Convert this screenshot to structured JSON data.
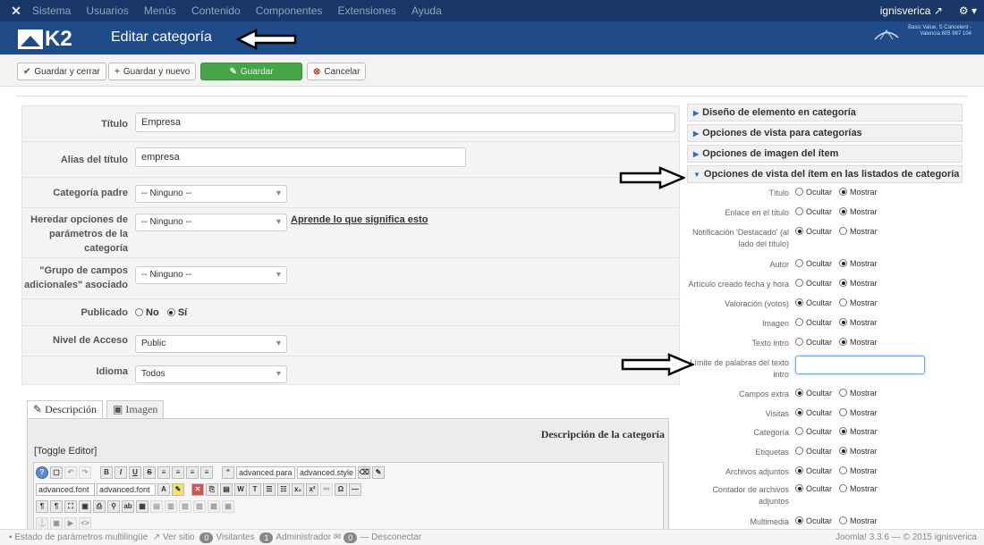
{
  "topbar": {
    "menu": [
      "Sistema",
      "Usuarios",
      "Menús",
      "Contenido",
      "Componentes",
      "Extensiones",
      "Ayuda"
    ],
    "user": "ignisverica"
  },
  "header": {
    "logo_text": "K2",
    "title": "Editar categoría",
    "brand_text": "Basic Value, S Cancelent - Valencia 605 987 104"
  },
  "toolbar": {
    "save_close": "Guardar y cerrar",
    "save_new": "Guardar y nuevo",
    "save": "Guardar",
    "cancel": "Cancelar"
  },
  "form": {
    "title_label": "Título",
    "title_value": "Empresa",
    "alias_label": "Alias del título",
    "alias_value": "empresa",
    "parent_label": "Categoría padre",
    "parent_value": "-- Ninguno --",
    "inherit_label": "Heredar opciones de parámetros de la categoría",
    "inherit_value": "-- Ninguno --",
    "inherit_link": "Aprende lo que significa esto",
    "extra_label": "\"Grupo de campos adicionales\" asociado",
    "extra_value": "-- Ninguno --",
    "published_label": "Publicado",
    "published_no": "No",
    "published_yes": "Sí",
    "access_label": "Nivel de Acceso",
    "access_value": "Public",
    "language_label": "Idioma",
    "language_value": "Todos"
  },
  "tabs": {
    "description": "Descripción",
    "image": "Imagen"
  },
  "editor": {
    "title": "Descripción de la categoría",
    "toggle": "[Toggle Editor]",
    "para_select": "advanced.para",
    "style_select": "advanced.style",
    "font_select": "advanced.font",
    "size_select": "advanced.font"
  },
  "sidebar": {
    "panels": [
      "Diseño de elemento en categoría",
      "Opciones de vista para categorías",
      "Opciones de imagen del ítem",
      "Opciones de vista del ítem en las listados de categoría"
    ],
    "hide": "Ocultar",
    "show": "Mostrar",
    "options": [
      {
        "label": "Título",
        "selected": "show"
      },
      {
        "label": "Enlace en el título",
        "selected": "show"
      },
      {
        "label": "Notificación 'Destacado' (al lado del título)",
        "selected": "hide"
      },
      {
        "label": "Autor",
        "selected": "show"
      },
      {
        "label": "Artículo creado fecha y hora",
        "selected": "show"
      },
      {
        "label": "Valoración (votos)",
        "selected": "hide"
      },
      {
        "label": "Imagen",
        "selected": "show"
      },
      {
        "label": "Texto intro",
        "selected": "show"
      },
      {
        "label": "Límite de palabras del texto intro",
        "selected": "input"
      },
      {
        "label": "Campos extra",
        "selected": "hide"
      },
      {
        "label": "Visitas",
        "selected": "hide"
      },
      {
        "label": "Categoría",
        "selected": "show"
      },
      {
        "label": "Etiquetas",
        "selected": "show"
      },
      {
        "label": "Archivos adjuntos",
        "selected": "hide"
      },
      {
        "label": "Contador de archivos adjuntos",
        "selected": "hide"
      },
      {
        "label": "Multimedia",
        "selected": "hide"
      }
    ]
  },
  "status": {
    "multilang": "Estado de parámetros multilingüe",
    "view_site": "Ver sitio",
    "visitors_count": "0",
    "visitors": "Visitantes",
    "admins_count": "1",
    "admins": "Administrador",
    "msg_count": "0",
    "logout": "Desconectar",
    "version": "Joomla! 3.3.6 — © 2015 ignisverica"
  }
}
